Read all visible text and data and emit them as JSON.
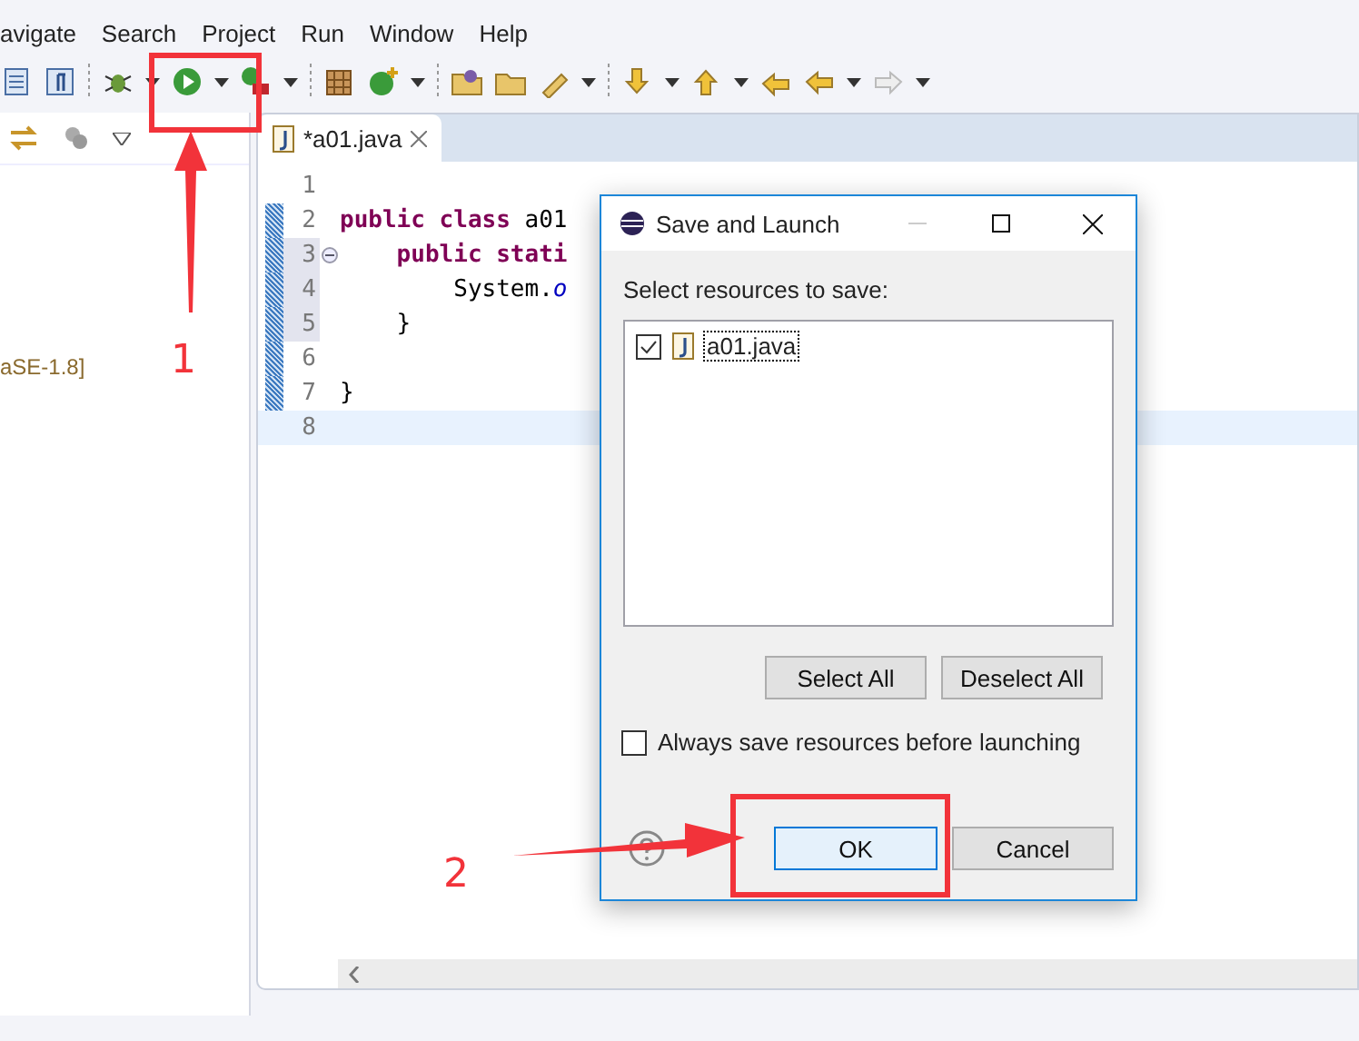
{
  "menu": [
    {
      "label": "avigate"
    },
    {
      "label": "Search"
    },
    {
      "label": "Project"
    },
    {
      "label": "Run"
    },
    {
      "label": "Window"
    },
    {
      "label": "Help"
    }
  ],
  "left_panel": {
    "text": "aSE-1.8]"
  },
  "editor": {
    "tab": {
      "label": "*a01.java",
      "selected": true
    },
    "lines": [
      {
        "number": "1",
        "changed": false,
        "highlighted": false,
        "foldable": false,
        "current": false
      },
      {
        "number": "2",
        "tokens": [
          {
            "text": "public class ",
            "kind": "keyword"
          },
          {
            "text": "a01",
            "kind": "plain"
          }
        ],
        "changed": true,
        "highlighted": false,
        "foldable": false,
        "current": false
      },
      {
        "number": "3",
        "tokens": [
          {
            "text": "    public stati",
            "kind": "keyword"
          }
        ],
        "changed": true,
        "highlighted": true,
        "foldable": true,
        "current": false
      },
      {
        "number": "4",
        "tokens": [
          {
            "text": "        System.",
            "kind": "plain"
          },
          {
            "text": "o",
            "kind": "field"
          }
        ],
        "changed": true,
        "highlighted": true,
        "foldable": false,
        "current": false
      },
      {
        "number": "5",
        "tokens": [
          {
            "text": "    }",
            "kind": "plain"
          }
        ],
        "changed": true,
        "highlighted": true,
        "foldable": false,
        "current": false
      },
      {
        "number": "6",
        "changed": true,
        "highlighted": false,
        "foldable": false,
        "current": false
      },
      {
        "number": "7",
        "tokens": [
          {
            "text": "}",
            "kind": "plain"
          }
        ],
        "changed": true,
        "highlighted": false,
        "foldable": false,
        "current": false
      },
      {
        "number": "8",
        "changed": false,
        "highlighted": false,
        "foldable": false,
        "current": true
      }
    ]
  },
  "dialog": {
    "title": "Save and Launch",
    "prompt": "Select resources to save:",
    "resources": [
      {
        "label": "a01.java",
        "checked": true
      }
    ],
    "select_all": "Select All",
    "deselect_all": "Deselect All",
    "always_save": {
      "label": "Always save resources before launching",
      "checked": false
    },
    "ok": "OK",
    "cancel": "Cancel"
  },
  "annotations": [
    {
      "label": "1"
    },
    {
      "label": "2"
    }
  ]
}
